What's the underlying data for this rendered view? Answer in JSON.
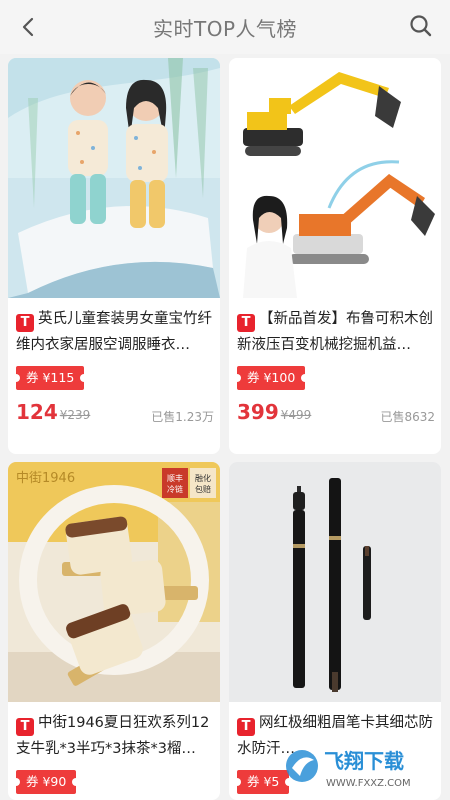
{
  "header": {
    "title": "实时TOP人气榜",
    "back_icon": "chevron-left-icon",
    "search_icon": "search-icon"
  },
  "badge_letter": "T",
  "products": [
    {
      "title": "英氏儿童套装男女童宝竹纤维内衣家居服空调服睡衣…",
      "coupon": "券 ¥115",
      "price": "124",
      "original": "¥239",
      "sold": "已售1.23万"
    },
    {
      "title": "【新品首发】布鲁可积木创新液压百变机械挖掘机益…",
      "coupon": "券 ¥100",
      "price": "399",
      "original": "¥499",
      "sold": "已售8632"
    },
    {
      "title": "中街1946夏日狂欢系列12支牛乳*3半巧*3抹茶*3榴…",
      "coupon": "券 ¥90",
      "image_text": {
        "brand": "中街1946",
        "stamp1": "顺丰冷链",
        "stamp2": "融化包赔"
      }
    },
    {
      "title": "网红极细粗眉笔卡其细芯防水防汗…",
      "coupon": "券 ¥5"
    }
  ],
  "watermark": {
    "text": "飞翔下载",
    "url": "WWW.FXXZ.COM"
  },
  "colors": {
    "accent": "#e8232d",
    "price": "#e2343b",
    "coupon": "#ee3b3b"
  }
}
